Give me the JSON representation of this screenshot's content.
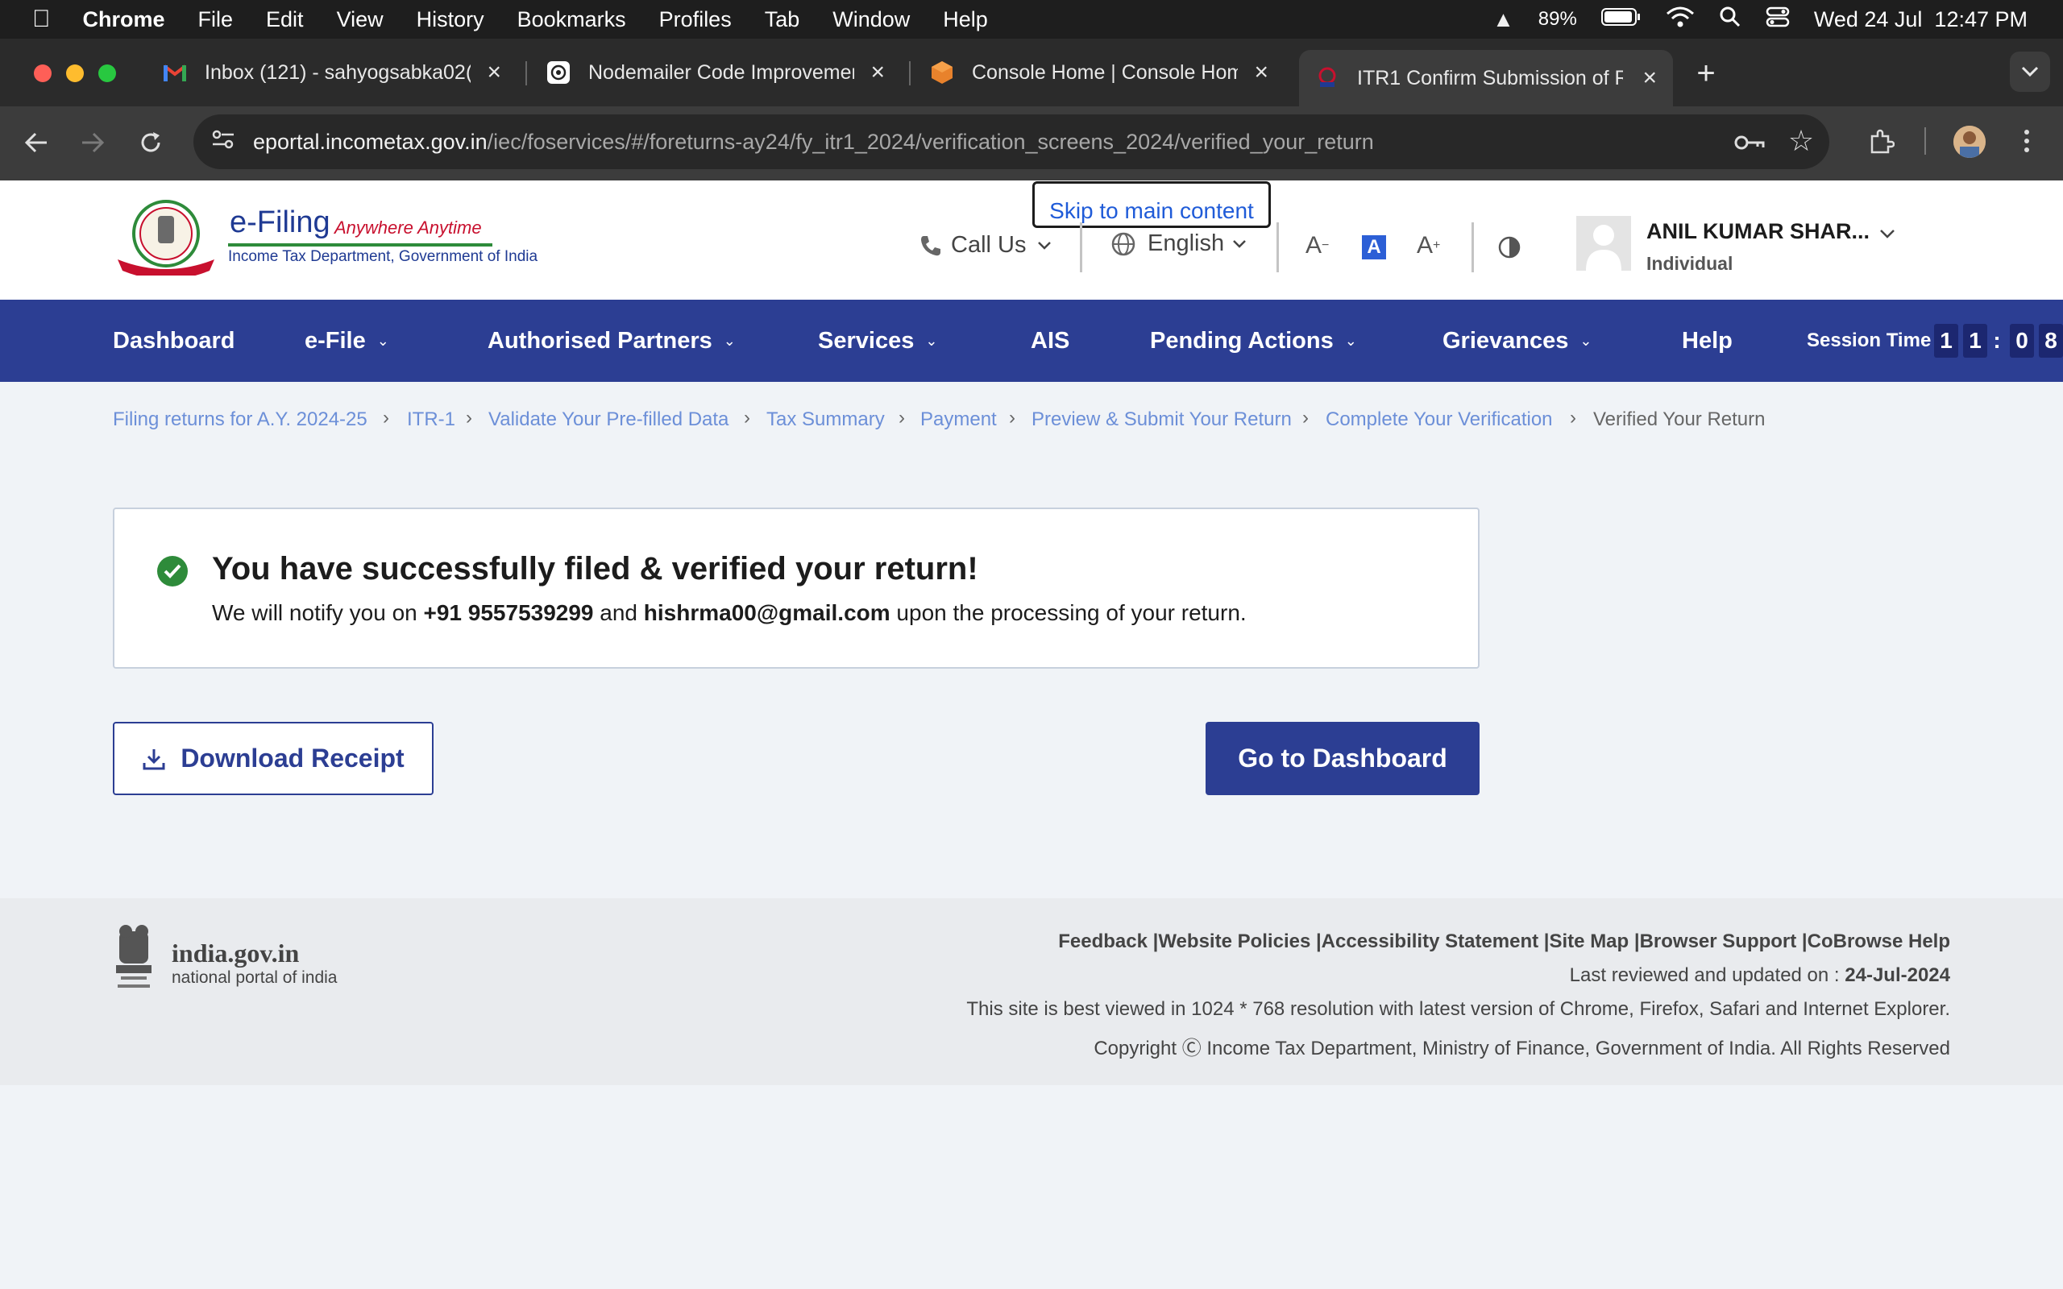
{
  "menubar": {
    "app": "Chrome",
    "items": [
      "File",
      "Edit",
      "View",
      "History",
      "Bookmarks",
      "Profiles",
      "Tab",
      "Window",
      "Help"
    ],
    "battery": "89%",
    "datetime": "Wed 24 Jul  12:47 PM"
  },
  "tabs": [
    {
      "title": "Inbox (121) - sahyogsabka02(",
      "icon": "gmail-icon"
    },
    {
      "title": "Nodemailer Code Improvemen",
      "icon": "chatgpt-icon"
    },
    {
      "title": "Console Home | Console Hom",
      "icon": "aws-icon"
    },
    {
      "title": "ITR1 Confirm Submission of R",
      "icon": "incometax-icon"
    }
  ],
  "url": {
    "host": "eportal.incometax.gov.in",
    "path": "/iec/foservices/#/foreturns-ay24/fy_itr1_2024/verification_screens_2024/verified_your_return"
  },
  "header": {
    "logo_title": "e-Filing",
    "logo_tagline": "Anywhere Anytime",
    "logo_subtitle": "Income Tax Department, Government of India",
    "skip_link": "Skip to main content",
    "call_us": "Call Us",
    "language": "English",
    "user_name": "ANIL KUMAR SHAR...",
    "user_type": "Individual"
  },
  "nav": {
    "items": [
      "Dashboard",
      "e-File",
      "Authorised Partners",
      "Services",
      "AIS",
      "Pending Actions",
      "Grievances",
      "Help"
    ],
    "session_label": "Session Time",
    "session_digits": [
      "1",
      "1",
      ":",
      "0",
      "8"
    ]
  },
  "breadcrumb": {
    "links": [
      "Filing returns for A.Y. 2024-25",
      "ITR-1",
      "Validate Your Pre-filled Data",
      "Tax Summary",
      "Payment",
      "Preview & Submit Your Return",
      "Complete Your Verification"
    ],
    "current": "Verified Your Return"
  },
  "main": {
    "success_title": "You have successfully filed & verified your return!",
    "notify_prefix": "We will notify you on ",
    "phone": "+91 9557539299",
    "notify_and": " and ",
    "email": "hishrma00@gmail.com",
    "notify_suffix": " upon the processing of your return.",
    "download_button": "Download Receipt",
    "dashboard_button": "Go to Dashboard"
  },
  "footer": {
    "portal_name": "india.gov.in",
    "portal_sub": "national portal of india",
    "links": "Feedback |Website Policies |Accessibility Statement |Site Map |Browser Support |CoBrowse Help",
    "reviewed_label": "Last reviewed and updated on : ",
    "reviewed_date": "24-Jul-2024",
    "best_viewed": "This site is best viewed in 1024 * 768 resolution with latest version of Chrome, Firefox, Safari and Internet Explorer.",
    "copyright": "Copyright Ⓒ Income Tax Department, Ministry of Finance, Government of India. All Rights Reserved"
  },
  "colors": {
    "nav_bg": "#2c3e93",
    "link": "#6c8fd8",
    "success": "#2e8b3a"
  }
}
